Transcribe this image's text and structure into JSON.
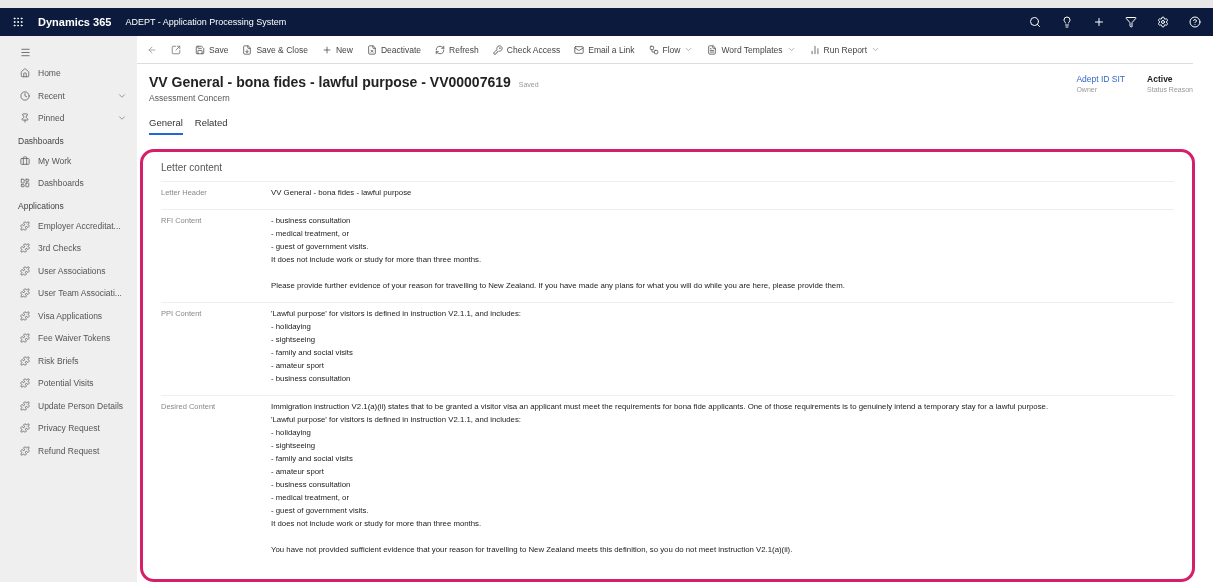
{
  "topbar": {
    "brand": "Dynamics 365",
    "app_name": "ADEPT - Application Processing System"
  },
  "sidebar": {
    "nav": [
      {
        "label": "Home",
        "expandable": false
      },
      {
        "label": "Recent",
        "expandable": true
      },
      {
        "label": "Pinned",
        "expandable": true
      }
    ],
    "groups": [
      {
        "title": "Dashboards",
        "items": [
          {
            "label": "My Work"
          },
          {
            "label": "Dashboards"
          }
        ]
      },
      {
        "title": "Applications",
        "items": [
          {
            "label": "Employer Accreditat..."
          },
          {
            "label": "3rd Checks"
          },
          {
            "label": "User Associations"
          },
          {
            "label": "User Team Associati..."
          },
          {
            "label": "Visa Applications"
          },
          {
            "label": "Fee Waiver Tokens"
          },
          {
            "label": "Risk Briefs"
          },
          {
            "label": "Potential Visits"
          },
          {
            "label": "Update Person Details"
          },
          {
            "label": "Privacy Request"
          },
          {
            "label": "Refund Request"
          }
        ]
      }
    ]
  },
  "toolbar": [
    {
      "label": "Save",
      "dropdown": false
    },
    {
      "label": "Save & Close",
      "dropdown": false
    },
    {
      "label": "New",
      "dropdown": false
    },
    {
      "label": "Deactivate",
      "dropdown": false
    },
    {
      "label": "Refresh",
      "dropdown": false
    },
    {
      "label": "Check Access",
      "dropdown": false
    },
    {
      "label": "Email a Link",
      "dropdown": false
    },
    {
      "label": "Flow",
      "dropdown": true
    },
    {
      "label": "Word Templates",
      "dropdown": true
    },
    {
      "label": "Run Report",
      "dropdown": true
    }
  ],
  "record": {
    "title": "VV General - bona fides - lawful purpose - VV00007619",
    "save_state": "Saved",
    "entity": "Assessment Concern",
    "header_fields": [
      {
        "value": "Adept ID SIT",
        "label": "Owner",
        "kind": "link"
      },
      {
        "value": "Active",
        "label": "Status Reason",
        "kind": "text"
      }
    ]
  },
  "tabs": [
    {
      "label": "General",
      "selected": true
    },
    {
      "label": "Related",
      "selected": false
    }
  ],
  "section": {
    "title": "Letter content",
    "fields": [
      {
        "label": "Letter Header",
        "paragraphs": [
          [
            "VV General - bona fides - lawful purpose"
          ]
        ]
      },
      {
        "label": "RFI Content",
        "paragraphs": [
          [
            "- business consultation",
            "- medical treatment, or",
            "- guest of government visits.",
            "It does not include work or study for more than three months."
          ],
          [
            "Please provide further evidence of your reason for travelling to New Zealand. If you have made any plans for what you will do while you are here, please provide them."
          ]
        ]
      },
      {
        "label": "PPI Content",
        "paragraphs": [
          [
            "'Lawful purpose' for visitors is defined in instruction V2.1.1, and includes:",
            "- holidaying",
            "- sightseeing",
            "- family and social visits",
            "- amateur sport",
            "- business consultation"
          ]
        ]
      },
      {
        "label": "Desired Content",
        "paragraphs": [
          [
            "Immigration instruction V2.1(a)(ii) states that to be granted a visitor visa an applicant must meet the requirements for bona fide applicants. One of those requirements is to genuinely intend a temporary stay for a lawful purpose.",
            "'Lawful purpose' for visitors is defined in instruction V2.1.1, and includes:",
            "- holidaying",
            "- sightseeing",
            "- family and social visits",
            "- amateur sport",
            "- business consultation",
            "- medical treatment, or",
            "- guest of government visits.",
            "It does not include work or study for more than three months."
          ],
          [
            "You have not provided sufficient evidence that your reason for travelling to New Zealand meets this definition, so you do not meet instruction V2.1(a)(ii)."
          ]
        ]
      }
    ]
  }
}
